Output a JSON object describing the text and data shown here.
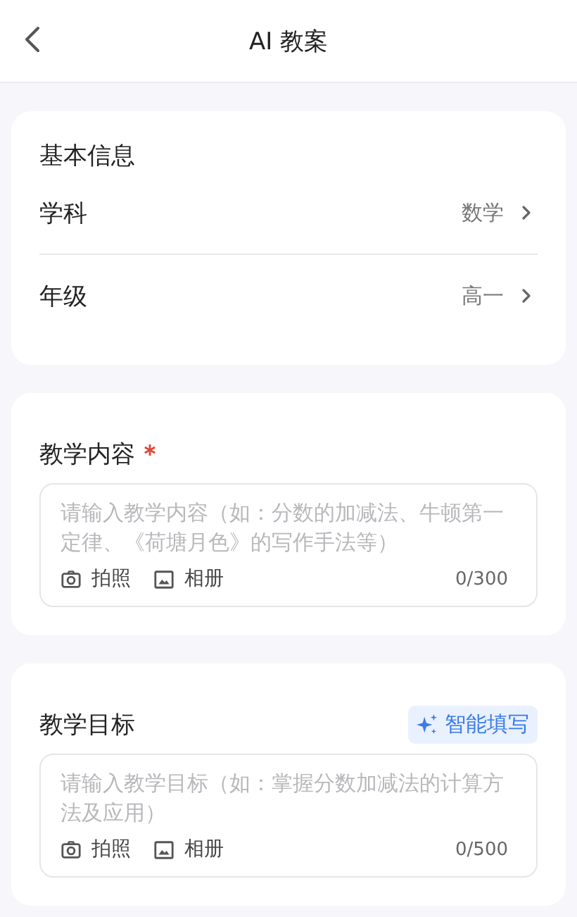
{
  "header": {
    "title": "AI 教案"
  },
  "basic_info": {
    "title": "基本信息",
    "rows": [
      {
        "label": "学科",
        "value": "数学"
      },
      {
        "label": "年级",
        "value": "高一"
      }
    ]
  },
  "sections": [
    {
      "title": "教学内容",
      "required": true,
      "placeholder": "请输入教学内容（如：分数的加减法、牛顿第一定律、《荷塘月色》的写作手法等）",
      "tools": [
        {
          "kind": "camera",
          "label": "拍照"
        },
        {
          "kind": "album",
          "label": "相册"
        }
      ],
      "counter": "0/300"
    },
    {
      "title": "教学目标",
      "required": false,
      "smart_fill": "智能填写",
      "placeholder": "请输入教学目标（如：掌握分数加减法的计算方法及应用）",
      "tools": [
        {
          "kind": "camera",
          "label": "拍照"
        },
        {
          "kind": "album",
          "label": "相册"
        }
      ],
      "counter": "0/500"
    }
  ]
}
